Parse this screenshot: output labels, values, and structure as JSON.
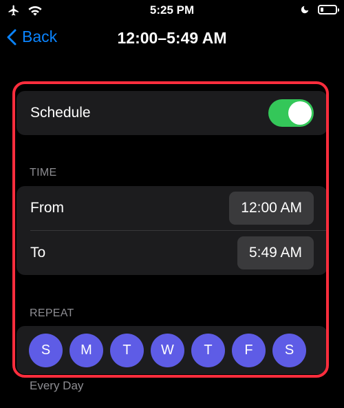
{
  "status_bar": {
    "time": "5:25 PM",
    "icons": [
      "airplane-icon",
      "wifi-icon",
      "moon-icon",
      "battery-icon"
    ]
  },
  "nav": {
    "back_label": "Back",
    "title": "12:00–5:49 AM"
  },
  "schedule": {
    "label": "Schedule",
    "enabled": true
  },
  "time_section": {
    "header": "TIME",
    "from_label": "From",
    "from_value": "12:00 AM",
    "to_label": "To",
    "to_value": "5:49 AM"
  },
  "repeat_section": {
    "header": "REPEAT",
    "days": [
      "S",
      "M",
      "T",
      "W",
      "T",
      "F",
      "S"
    ],
    "summary": "Every Day"
  },
  "colors": {
    "accent": "#0a84ff",
    "toggle_on": "#34c759",
    "day_selected": "#5e5ce6",
    "highlight": "#ff2d3d",
    "card": "#1c1c1e"
  }
}
